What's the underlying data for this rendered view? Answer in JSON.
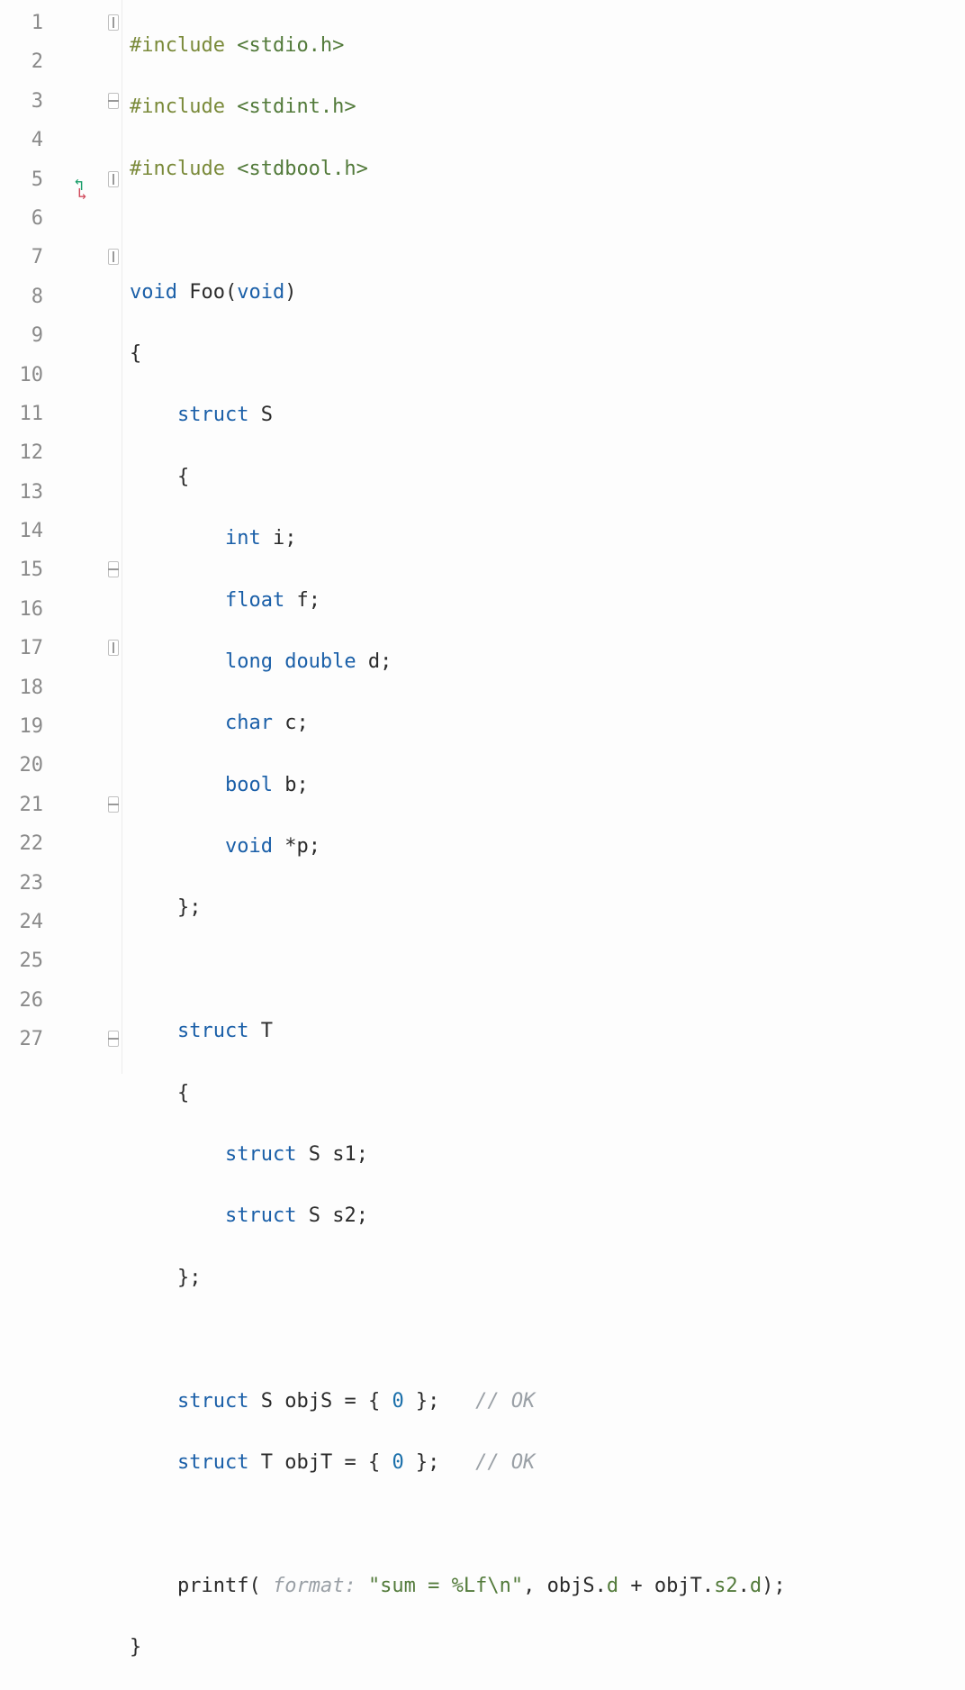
{
  "line_numbers": [
    "1",
    "2",
    "3",
    "4",
    "5",
    "6",
    "7",
    "8",
    "9",
    "10",
    "11",
    "12",
    "13",
    "14",
    "15",
    "16",
    "17",
    "18",
    "19",
    "20",
    "21",
    "22",
    "23",
    "24",
    "25",
    "26",
    "27"
  ],
  "code": {
    "l1": {
      "dir": "#include",
      "str": " <stdio.h>"
    },
    "l2": {
      "dir": "#include",
      "str": " <stdint.h>"
    },
    "l3": {
      "dir": "#include",
      "str": " <stdbool.h>"
    },
    "l5": {
      "kw_void": "void",
      "fn": " Foo",
      "paren_open": "(",
      "kw_void2": "void",
      "paren_close": ")"
    },
    "l6": {
      "brace": "{"
    },
    "l7": {
      "kw_struct": "struct",
      "name": " S"
    },
    "l8": {
      "brace": "    {"
    },
    "l9": {
      "type": "int",
      "var": " i",
      "semi": ";"
    },
    "l10": {
      "type": "float",
      "var": " f",
      "semi": ";"
    },
    "l11": {
      "type": "long double",
      "var": " d",
      "semi": ";"
    },
    "l12": {
      "type": "char",
      "var": " c",
      "semi": ";"
    },
    "l13": {
      "type": "bool",
      "var": " b",
      "semi": ";"
    },
    "l14": {
      "type": "void",
      "var": " *p",
      "semi": ";"
    },
    "l15": {
      "close": "    };"
    },
    "l17": {
      "kw_struct": "struct",
      "name": " T"
    },
    "l18": {
      "brace": "    {"
    },
    "l19": {
      "kw_struct": "struct",
      "stype": " S",
      "var": " s1",
      "semi": ";"
    },
    "l20": {
      "kw_struct": "struct",
      "stype": " S",
      "var": " s2",
      "semi": ";"
    },
    "l21": {
      "close": "    };"
    },
    "l23": {
      "kw_struct": "struct",
      "stype": " S",
      "var": " objS",
      "eq": " = { ",
      "num": "0",
      "end": " };",
      "comment": "   // OK"
    },
    "l24": {
      "kw_struct": "struct",
      "stype": " T",
      "var": " objT",
      "eq": " = { ",
      "num": "0",
      "end": " };",
      "comment": "   // OK"
    },
    "l26": {
      "fn": "printf",
      "open": "( ",
      "hint": "format: ",
      "str": "\"sum = %Lf\\n\"",
      "sep": ", ",
      "expr1": "objS",
      "dot1": ".",
      "f1": "d",
      "plus": " + ",
      "expr2": "objT",
      "dot2": ".",
      "f2": "s2",
      "dot3": ".",
      "f3": "d",
      "close": ");"
    },
    "l27": {
      "brace": "}"
    }
  }
}
